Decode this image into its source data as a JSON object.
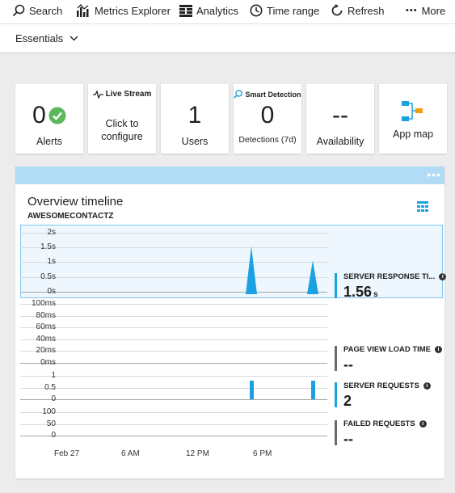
{
  "toolbar": {
    "search": "Search",
    "metrics_explorer": "Metrics Explorer",
    "analytics": "Analytics",
    "time_range": "Time range",
    "refresh": "Refresh",
    "more": "More"
  },
  "essentials": {
    "label": "Essentials"
  },
  "tiles": {
    "alerts": {
      "value": "0",
      "label": "Alerts"
    },
    "live_stream": {
      "title": "Live Stream",
      "label_line1": "Click to",
      "label_line2": "configure"
    },
    "users": {
      "value": "1",
      "label": "Users"
    },
    "smart_detection": {
      "title": "Smart Detection",
      "value": "0",
      "label": "Detections (7d)"
    },
    "availability": {
      "value": "--",
      "label": "Availability"
    },
    "app_map": {
      "label": "App map"
    }
  },
  "timeline": {
    "title": "Overview timeline",
    "subtitle": "AWESOMECONTACTZ",
    "menu": "•••",
    "y_labels_response": [
      "2s",
      "1.5s",
      "1s",
      "0.5s",
      "0s"
    ],
    "y_labels_pageview": [
      "100ms",
      "80ms",
      "60ms",
      "40ms",
      "20ms",
      "0ms"
    ],
    "y_labels_requests": [
      "1",
      "0.5",
      "0"
    ],
    "y_labels_failed": [
      "100",
      "50",
      "0"
    ],
    "x_labels": [
      "Feb 27",
      "6 AM",
      "12 PM",
      "6 PM"
    ],
    "metrics": {
      "server_response": {
        "name": "SERVER RESPONSE TI...",
        "value": "1.56",
        "unit": "s",
        "color": "#1ba1e2"
      },
      "page_view": {
        "name": "PAGE VIEW LOAD TIME",
        "value": "--",
        "color": "#6b6b6b"
      },
      "server_requests": {
        "name": "SERVER REQUESTS",
        "value": "2",
        "color": "#1ba1e2"
      },
      "failed_requests": {
        "name": "FAILED REQUESTS",
        "value": "--",
        "color": "#6b6b6b"
      }
    }
  },
  "chart_data": {
    "type": "area",
    "x": [
      "Feb 27",
      "6 AM",
      "12 PM",
      "6 PM"
    ],
    "series": [
      {
        "name": "SERVER RESPONSE TI...",
        "values": [
          0,
          1.56,
          0,
          1.1,
          0
        ],
        "ylim": [
          0,
          2
        ]
      },
      {
        "name": "SERVER REQUESTS",
        "values": [
          0,
          1,
          0,
          1,
          0
        ],
        "ylim": [
          0,
          1
        ]
      }
    ]
  },
  "colors": {
    "accent": "#1ba1e2",
    "success": "#5cb85c",
    "card_bar": "#b2dcf5"
  }
}
